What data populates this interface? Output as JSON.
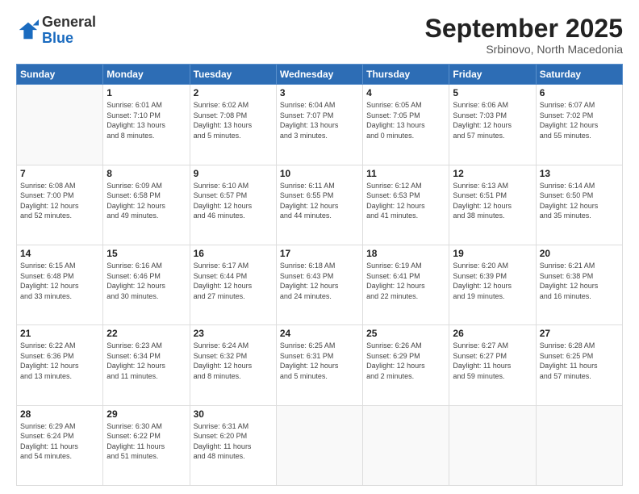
{
  "logo": {
    "general": "General",
    "blue": "Blue"
  },
  "header": {
    "month": "September 2025",
    "location": "Srbinovo, North Macedonia"
  },
  "weekdays": [
    "Sunday",
    "Monday",
    "Tuesday",
    "Wednesday",
    "Thursday",
    "Friday",
    "Saturday"
  ],
  "weeks": [
    [
      {
        "day": "",
        "info": ""
      },
      {
        "day": "1",
        "info": "Sunrise: 6:01 AM\nSunset: 7:10 PM\nDaylight: 13 hours\nand 8 minutes."
      },
      {
        "day": "2",
        "info": "Sunrise: 6:02 AM\nSunset: 7:08 PM\nDaylight: 13 hours\nand 5 minutes."
      },
      {
        "day": "3",
        "info": "Sunrise: 6:04 AM\nSunset: 7:07 PM\nDaylight: 13 hours\nand 3 minutes."
      },
      {
        "day": "4",
        "info": "Sunrise: 6:05 AM\nSunset: 7:05 PM\nDaylight: 13 hours\nand 0 minutes."
      },
      {
        "day": "5",
        "info": "Sunrise: 6:06 AM\nSunset: 7:03 PM\nDaylight: 12 hours\nand 57 minutes."
      },
      {
        "day": "6",
        "info": "Sunrise: 6:07 AM\nSunset: 7:02 PM\nDaylight: 12 hours\nand 55 minutes."
      }
    ],
    [
      {
        "day": "7",
        "info": "Sunrise: 6:08 AM\nSunset: 7:00 PM\nDaylight: 12 hours\nand 52 minutes."
      },
      {
        "day": "8",
        "info": "Sunrise: 6:09 AM\nSunset: 6:58 PM\nDaylight: 12 hours\nand 49 minutes."
      },
      {
        "day": "9",
        "info": "Sunrise: 6:10 AM\nSunset: 6:57 PM\nDaylight: 12 hours\nand 46 minutes."
      },
      {
        "day": "10",
        "info": "Sunrise: 6:11 AM\nSunset: 6:55 PM\nDaylight: 12 hours\nand 44 minutes."
      },
      {
        "day": "11",
        "info": "Sunrise: 6:12 AM\nSunset: 6:53 PM\nDaylight: 12 hours\nand 41 minutes."
      },
      {
        "day": "12",
        "info": "Sunrise: 6:13 AM\nSunset: 6:51 PM\nDaylight: 12 hours\nand 38 minutes."
      },
      {
        "day": "13",
        "info": "Sunrise: 6:14 AM\nSunset: 6:50 PM\nDaylight: 12 hours\nand 35 minutes."
      }
    ],
    [
      {
        "day": "14",
        "info": "Sunrise: 6:15 AM\nSunset: 6:48 PM\nDaylight: 12 hours\nand 33 minutes."
      },
      {
        "day": "15",
        "info": "Sunrise: 6:16 AM\nSunset: 6:46 PM\nDaylight: 12 hours\nand 30 minutes."
      },
      {
        "day": "16",
        "info": "Sunrise: 6:17 AM\nSunset: 6:44 PM\nDaylight: 12 hours\nand 27 minutes."
      },
      {
        "day": "17",
        "info": "Sunrise: 6:18 AM\nSunset: 6:43 PM\nDaylight: 12 hours\nand 24 minutes."
      },
      {
        "day": "18",
        "info": "Sunrise: 6:19 AM\nSunset: 6:41 PM\nDaylight: 12 hours\nand 22 minutes."
      },
      {
        "day": "19",
        "info": "Sunrise: 6:20 AM\nSunset: 6:39 PM\nDaylight: 12 hours\nand 19 minutes."
      },
      {
        "day": "20",
        "info": "Sunrise: 6:21 AM\nSunset: 6:38 PM\nDaylight: 12 hours\nand 16 minutes."
      }
    ],
    [
      {
        "day": "21",
        "info": "Sunrise: 6:22 AM\nSunset: 6:36 PM\nDaylight: 12 hours\nand 13 minutes."
      },
      {
        "day": "22",
        "info": "Sunrise: 6:23 AM\nSunset: 6:34 PM\nDaylight: 12 hours\nand 11 minutes."
      },
      {
        "day": "23",
        "info": "Sunrise: 6:24 AM\nSunset: 6:32 PM\nDaylight: 12 hours\nand 8 minutes."
      },
      {
        "day": "24",
        "info": "Sunrise: 6:25 AM\nSunset: 6:31 PM\nDaylight: 12 hours\nand 5 minutes."
      },
      {
        "day": "25",
        "info": "Sunrise: 6:26 AM\nSunset: 6:29 PM\nDaylight: 12 hours\nand 2 minutes."
      },
      {
        "day": "26",
        "info": "Sunrise: 6:27 AM\nSunset: 6:27 PM\nDaylight: 11 hours\nand 59 minutes."
      },
      {
        "day": "27",
        "info": "Sunrise: 6:28 AM\nSunset: 6:25 PM\nDaylight: 11 hours\nand 57 minutes."
      }
    ],
    [
      {
        "day": "28",
        "info": "Sunrise: 6:29 AM\nSunset: 6:24 PM\nDaylight: 11 hours\nand 54 minutes."
      },
      {
        "day": "29",
        "info": "Sunrise: 6:30 AM\nSunset: 6:22 PM\nDaylight: 11 hours\nand 51 minutes."
      },
      {
        "day": "30",
        "info": "Sunrise: 6:31 AM\nSunset: 6:20 PM\nDaylight: 11 hours\nand 48 minutes."
      },
      {
        "day": "",
        "info": ""
      },
      {
        "day": "",
        "info": ""
      },
      {
        "day": "",
        "info": ""
      },
      {
        "day": "",
        "info": ""
      }
    ]
  ]
}
